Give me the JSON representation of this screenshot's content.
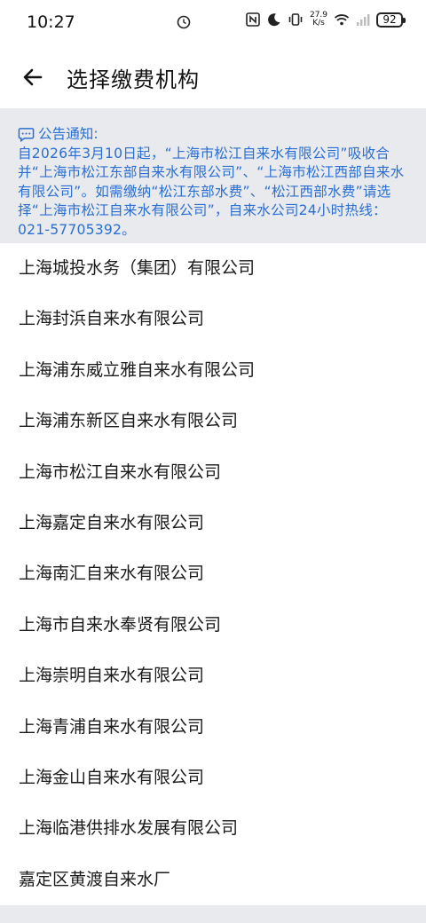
{
  "status_bar": {
    "time": "10:27",
    "network_speed_value": "27.9",
    "network_speed_unit": "K/s",
    "battery": "92",
    "icons": [
      "clock-badge-icon",
      "nfc-icon",
      "moon-icon",
      "vibrate-icon",
      "wifi-icon",
      "signal-icon"
    ]
  },
  "header": {
    "title": "选择缴费机构",
    "back_icon": "back-arrow-icon"
  },
  "notice": {
    "title": "公告通知:",
    "body": "自2026年3月10日起，“上海市松江自来水有限公司”吸收合并“上海市松江东部自来水有限公司”、“上海市松江西部自来水有限公司”。如需缴纳“松江东部水费”、“松江西部水费”请选择“上海市松江自来水有限公司”，自来水公司24小时热线：021-57705392。",
    "icon": "message-icon",
    "color": "#2a6fd1",
    "background": "#e9eaee"
  },
  "organizations": [
    {
      "label": "上海城投水务（集团）有限公司"
    },
    {
      "label": "上海封浜自来水有限公司"
    },
    {
      "label": "上海浦东威立雅自来水有限公司"
    },
    {
      "label": "上海浦东新区自来水有限公司"
    },
    {
      "label": "上海市松江自来水有限公司"
    },
    {
      "label": "上海嘉定自来水有限公司"
    },
    {
      "label": "上海南汇自来水有限公司"
    },
    {
      "label": "上海市自来水奉贤有限公司"
    },
    {
      "label": "上海崇明自来水有限公司"
    },
    {
      "label": "上海青浦自来水有限公司"
    },
    {
      "label": "上海金山自来水有限公司"
    },
    {
      "label": "上海临港供排水发展有限公司"
    },
    {
      "label": "嘉定区黄渡自来水厂"
    }
  ]
}
